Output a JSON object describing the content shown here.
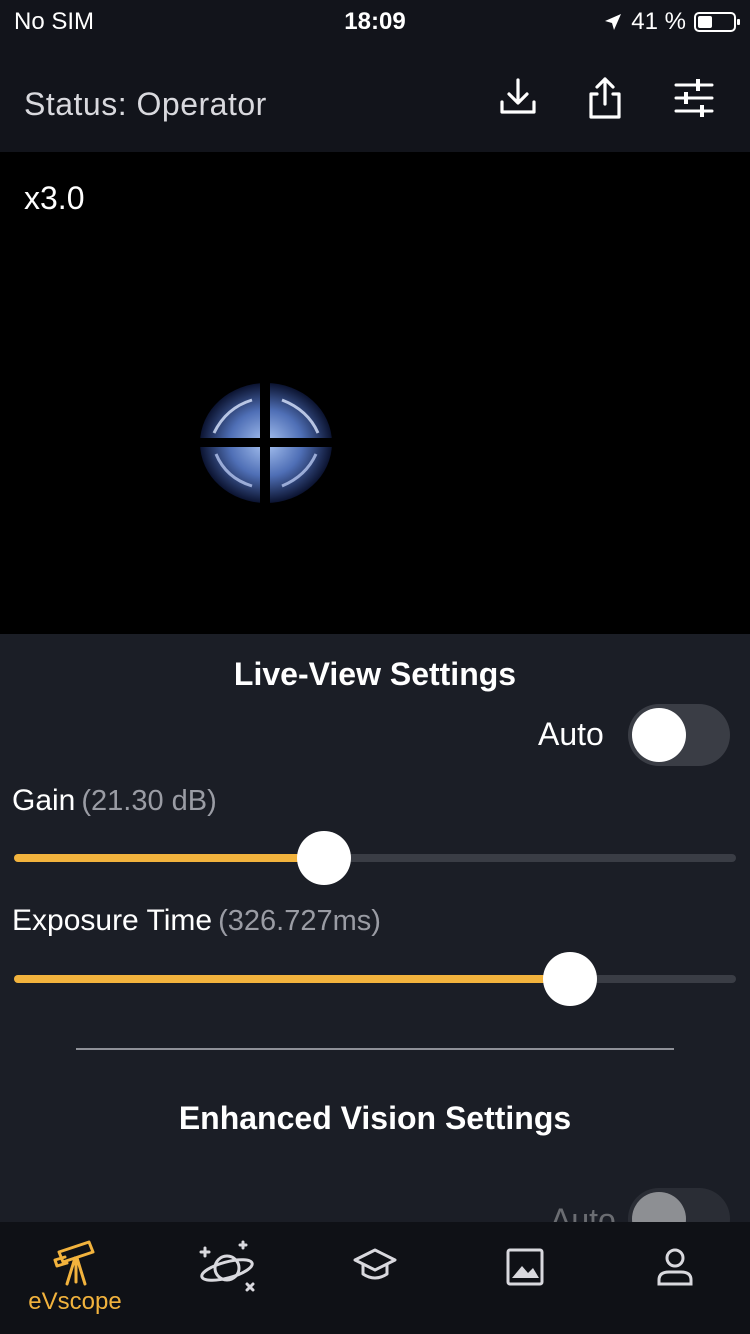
{
  "status_bar": {
    "carrier": "No SIM",
    "time": "18:09",
    "battery_text": "41 %",
    "battery_level": 0.41,
    "location_icon": "location-arrow-icon"
  },
  "nav": {
    "title": "Status: Operator",
    "icons": [
      "download-icon",
      "share-icon",
      "sliders-icon"
    ]
  },
  "viewer": {
    "zoom": "x3.0"
  },
  "live_view": {
    "title": "Live-View Settings",
    "auto_label": "Auto",
    "auto_on": false,
    "gain_label": "Gain",
    "gain_value": "(21.30 dB)",
    "gain_fraction": 0.43,
    "exposure_label": "Exposure Time",
    "exposure_value": "(326.727ms)",
    "exposure_fraction": 0.77
  },
  "enhanced": {
    "title": "Enhanced Vision Settings",
    "auto_label": "Auto",
    "auto_on": false
  },
  "tabbar": {
    "items": [
      {
        "label": "eVscope",
        "icon": "telescope-icon",
        "active": true
      },
      {
        "label": "",
        "icon": "planet-icon",
        "active": false
      },
      {
        "label": "",
        "icon": "graduation-cap-icon",
        "active": false
      },
      {
        "label": "",
        "icon": "image-icon",
        "active": false
      },
      {
        "label": "",
        "icon": "user-icon",
        "active": false
      }
    ]
  },
  "colors": {
    "accent": "#f2b33d",
    "background": "#12141b",
    "panel": "#1b1e26",
    "track": "#3a3d45"
  }
}
